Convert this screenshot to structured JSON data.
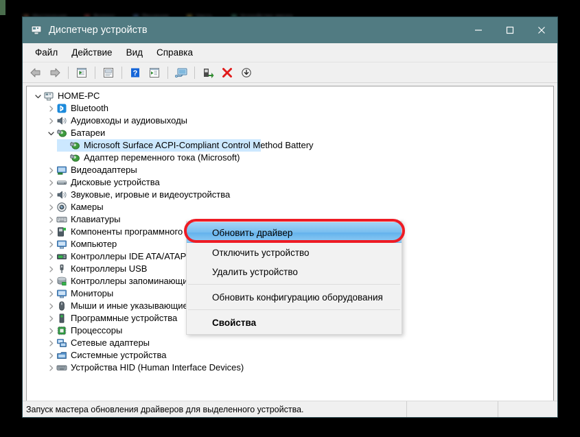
{
  "backdrop": {
    "tabs": [
      {
        "label": "Инструкция",
        "color": "#7a4f3a"
      },
      {
        "label": "Вопрос",
        "color": "#8a3a3a"
      },
      {
        "label": "Решение",
        "color": "#3f5f8a"
      },
      {
        "label": "Часть",
        "color": "#8a7a3a"
      },
      {
        "label": "Устройство ввода",
        "color": "#3a7a6a"
      }
    ]
  },
  "window": {
    "title": "Диспетчер устройств",
    "title_icon": "device-manager-icon",
    "titlebar_color": "#517b82",
    "controls": {
      "minimize": "minimize-icon",
      "maximize": "maximize-icon",
      "close": "close-icon"
    }
  },
  "menubar": {
    "items": [
      {
        "label": "Файл"
      },
      {
        "label": "Действие"
      },
      {
        "label": "Вид"
      },
      {
        "label": "Справка"
      }
    ]
  },
  "toolbar": {
    "buttons": [
      {
        "name": "back-arrow-icon"
      },
      {
        "name": "forward-arrow-icon"
      },
      {
        "name": "separator-1"
      },
      {
        "name": "show-hidden-devices-icon"
      },
      {
        "name": "separator-2"
      },
      {
        "name": "properties-icon"
      },
      {
        "name": "separator-3"
      },
      {
        "name": "help-icon"
      },
      {
        "name": "scan-hardware-icon"
      },
      {
        "name": "separator-4"
      },
      {
        "name": "console-icon"
      },
      {
        "name": "separator-5"
      },
      {
        "name": "update-driver-icon"
      },
      {
        "name": "uninstall-device-icon"
      },
      {
        "name": "disable-device-icon"
      }
    ]
  },
  "tree": {
    "items": [
      {
        "label": "HOME-PC",
        "depth": 0,
        "state": "expanded",
        "icon": "computer-root-icon",
        "selected": false
      },
      {
        "label": "Bluetooth",
        "depth": 1,
        "state": "collapsed",
        "icon": "bluetooth-icon",
        "selected": false
      },
      {
        "label": "Аудиовходы и аудиовыходы",
        "depth": 1,
        "state": "collapsed",
        "icon": "audio-icon",
        "selected": false
      },
      {
        "label": "Батареи",
        "depth": 1,
        "state": "expanded",
        "icon": "battery-icon",
        "selected": false
      },
      {
        "label": "Microsoft Surface ACPI-Compliant Control Method Battery",
        "depth": 2,
        "state": "leaf",
        "icon": "battery-icon",
        "selected": true
      },
      {
        "label": "Адаптер переменного тока (Microsoft)",
        "depth": 2,
        "state": "leaf",
        "icon": "battery-icon",
        "selected": false
      },
      {
        "label": "Видеоадаптеры",
        "depth": 1,
        "state": "collapsed",
        "icon": "display-adapter-icon",
        "selected": false
      },
      {
        "label": "Дисковые устройства",
        "depth": 1,
        "state": "collapsed",
        "icon": "disk-drive-icon",
        "selected": false
      },
      {
        "label": "Звуковые, игровые и видеоустройства",
        "depth": 1,
        "state": "collapsed",
        "icon": "sound-icon",
        "selected": false
      },
      {
        "label": "Камеры",
        "depth": 1,
        "state": "collapsed",
        "icon": "camera-icon",
        "selected": false
      },
      {
        "label": "Клавиатуры",
        "depth": 1,
        "state": "collapsed",
        "icon": "keyboard-icon",
        "selected": false
      },
      {
        "label": "Компоненты программного обеспечения",
        "depth": 1,
        "state": "collapsed",
        "icon": "software-component-icon",
        "selected": false
      },
      {
        "label": "Компьютер",
        "depth": 1,
        "state": "collapsed",
        "icon": "computer-icon",
        "selected": false
      },
      {
        "label": "Контроллеры IDE ATA/ATAPI",
        "depth": 1,
        "state": "collapsed",
        "icon": "ide-controller-icon",
        "selected": false
      },
      {
        "label": "Контроллеры USB",
        "depth": 1,
        "state": "collapsed",
        "icon": "usb-controller-icon",
        "selected": false
      },
      {
        "label": "Контроллеры запоминающих устройств",
        "depth": 1,
        "state": "collapsed",
        "icon": "storage-controller-icon",
        "selected": false
      },
      {
        "label": "Мониторы",
        "depth": 1,
        "state": "collapsed",
        "icon": "monitor-icon",
        "selected": false
      },
      {
        "label": "Мыши и иные указывающие устройства",
        "depth": 1,
        "state": "collapsed",
        "icon": "mouse-icon",
        "selected": false
      },
      {
        "label": "Программные устройства",
        "depth": 1,
        "state": "collapsed",
        "icon": "software-device-icon",
        "selected": false
      },
      {
        "label": "Процессоры",
        "depth": 1,
        "state": "collapsed",
        "icon": "processor-icon",
        "selected": false
      },
      {
        "label": "Сетевые адаптеры",
        "depth": 1,
        "state": "collapsed",
        "icon": "network-adapter-icon",
        "selected": false
      },
      {
        "label": "Системные устройства",
        "depth": 1,
        "state": "collapsed",
        "icon": "system-device-icon",
        "selected": false
      },
      {
        "label": "Устройства HID (Human Interface Devices)",
        "depth": 1,
        "state": "collapsed",
        "icon": "hid-device-icon",
        "selected": false
      }
    ]
  },
  "context_menu": {
    "items": [
      {
        "label": "Обновить драйвер",
        "highlighted": true,
        "bold": false
      },
      {
        "label": "Отключить устройство",
        "highlighted": false,
        "bold": false
      },
      {
        "label": "Удалить устройство",
        "highlighted": false,
        "bold": false
      },
      {
        "separator": true
      },
      {
        "label": "Обновить конфигурацию оборудования",
        "highlighted": false,
        "bold": false
      },
      {
        "separator": true
      },
      {
        "label": "Свойства",
        "highlighted": false,
        "bold": true
      }
    ]
  },
  "annotation": {
    "color": "#ee1b24",
    "shape": "rounded-rectangle-highlight"
  },
  "statusbar": {
    "text": "Запуск мастера обновления драйверов для выделенного устройства."
  }
}
